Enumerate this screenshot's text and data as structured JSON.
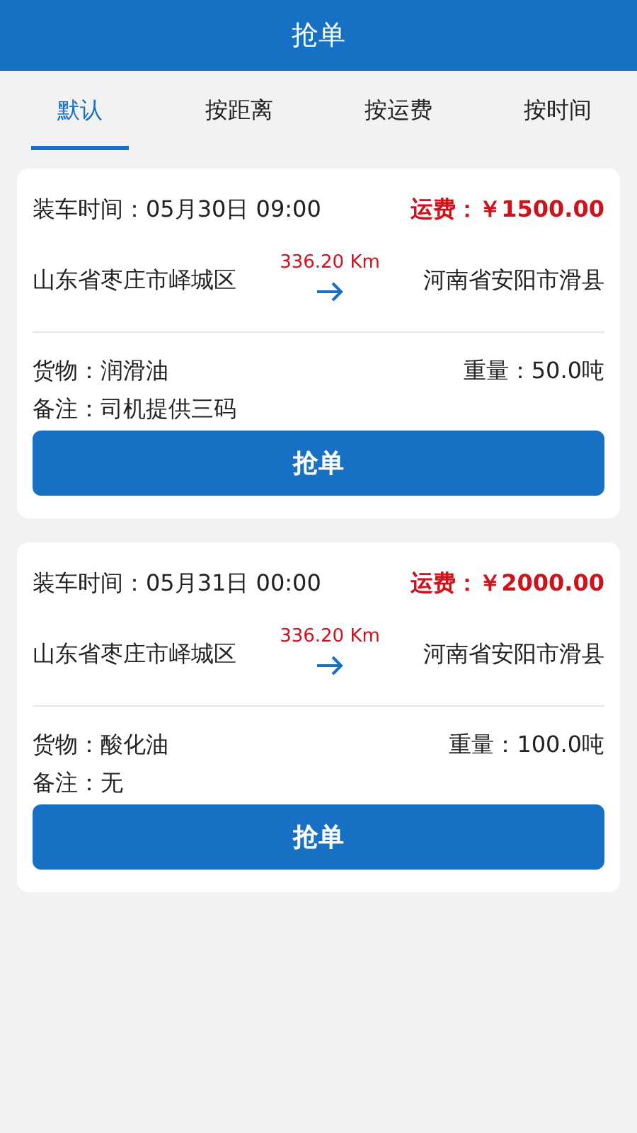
{
  "header": {
    "title": "抢单"
  },
  "tabs": [
    {
      "label": "默认",
      "selected": true
    },
    {
      "label": "按距离",
      "selected": false
    },
    {
      "label": "按运费",
      "selected": false
    },
    {
      "label": "按时间",
      "selected": false
    }
  ],
  "orders": [
    {
      "load_time": "装车时间：05月30日 09:00",
      "fee": "运费：￥1500.00",
      "origin": "山东省枣庄市峄城区",
      "distance": "336.20 Km",
      "destination": "河南省安阳市滑县",
      "cargo": "货物：润滑油",
      "weight": "重量：50.0吨",
      "note": "备注：司机提供三码",
      "button": "抢单"
    },
    {
      "load_time": "装车时间：05月31日 00:00",
      "fee": "运费：￥2000.00",
      "origin": "山东省枣庄市峄城区",
      "distance": "336.20 Km",
      "destination": "河南省安阳市滑县",
      "cargo": "货物：酸化油",
      "weight": "重量：100.0吨",
      "note": "备注：无",
      "button": "抢单"
    }
  ]
}
